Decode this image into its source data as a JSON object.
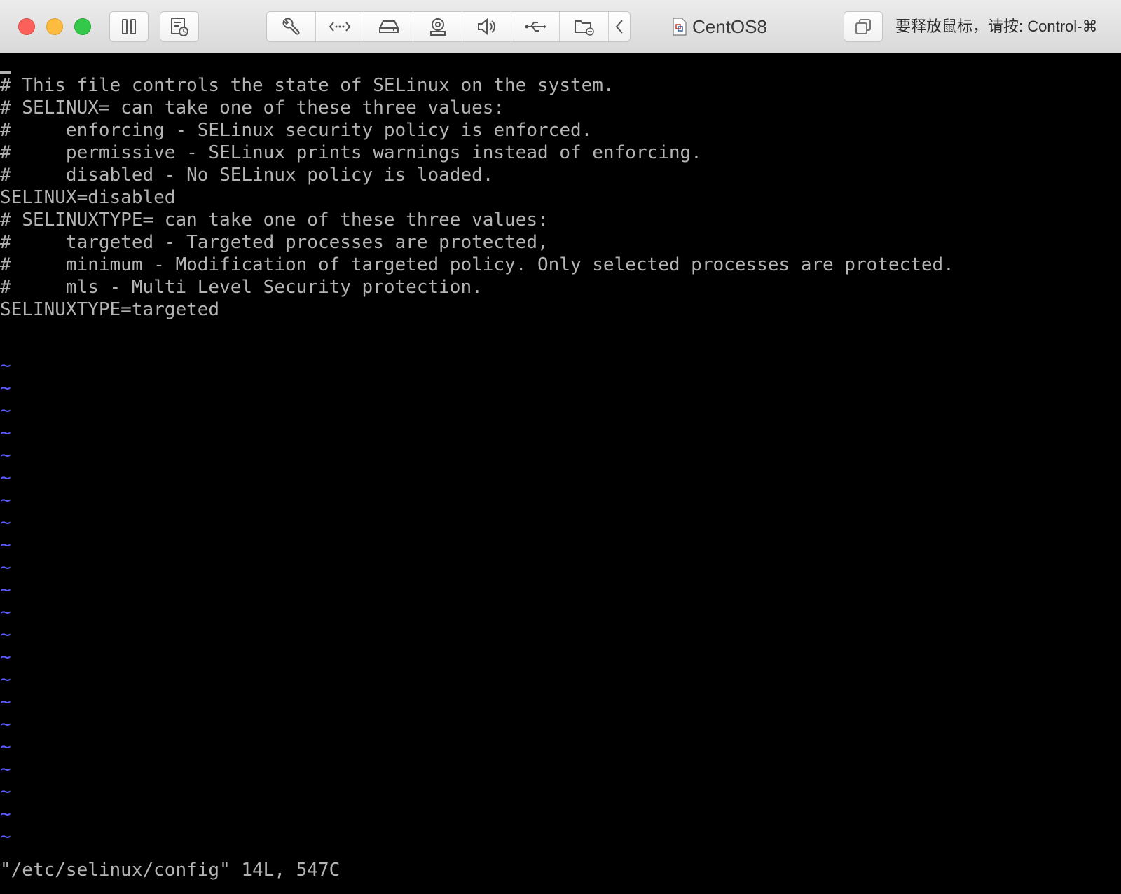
{
  "window": {
    "title": "CentOS8",
    "release_hint": "要释放鼠标，请按: Control-⌘"
  },
  "toolbar": {
    "pause_icon": "pause-icon",
    "snapshot_icon": "snapshot-icon",
    "settings_icon": "wrench-icon",
    "network_icon": "network-icon",
    "disk_icon": "hard-disk-icon",
    "camera_icon": "camera-icon",
    "sound_icon": "speaker-icon",
    "usb_icon": "usb-icon",
    "shared_folder_icon": "shared-folder-icon",
    "collapse_icon": "chevron-left-icon",
    "unity_icon": "windows-stack-icon"
  },
  "terminal": {
    "lines": [
      "# This file controls the state of SELinux on the system.",
      "# SELINUX= can take one of these three values:",
      "#     enforcing - SELinux security policy is enforced.",
      "#     permissive - SELinux prints warnings instead of enforcing.",
      "#     disabled - No SELinux policy is loaded.",
      "SELINUX=disabled",
      "# SELINUXTYPE= can take one of these three values:",
      "#     targeted - Targeted processes are protected,",
      "#     minimum - Modification of targeted policy. Only selected processes are protected.",
      "#     mls - Multi Level Security protection.",
      "SELINUXTYPE=targeted"
    ],
    "empty_line_marker": "~",
    "status_line": "\"/etc/selinux/config\" 14L, 547C",
    "colors": {
      "text": "#b4b4b4",
      "tilde": "#5a5aff",
      "background": "#000000"
    }
  }
}
